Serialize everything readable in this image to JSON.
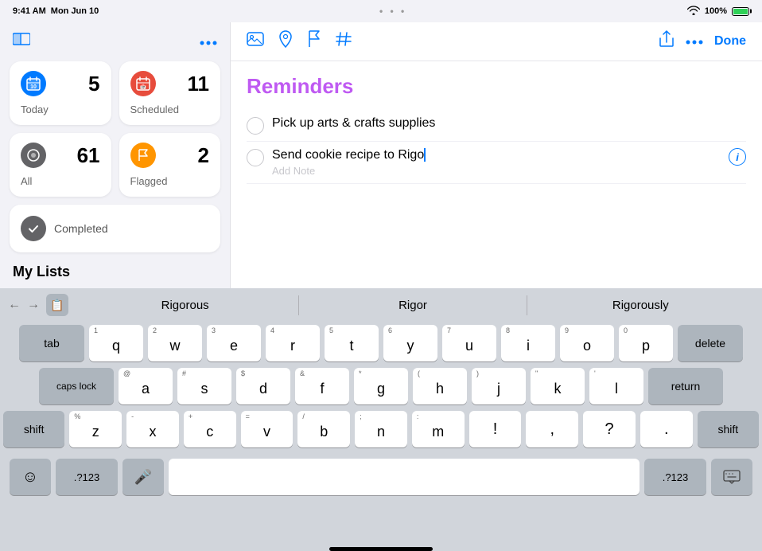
{
  "statusBar": {
    "time": "9:41 AM",
    "date": "Mon Jun 10",
    "centerDots": "•  •  •",
    "wifi": "WiFi",
    "battery": "100%"
  },
  "sidebar": {
    "moreIcon": "•••",
    "smartLists": [
      {
        "id": "today",
        "label": "Today",
        "count": "5",
        "iconColor": "#007aff",
        "iconSymbol": "📅"
      },
      {
        "id": "scheduled",
        "label": "Scheduled",
        "count": "11",
        "iconColor": "#e74c3c",
        "iconSymbol": "📅"
      },
      {
        "id": "all",
        "label": "All",
        "count": "61",
        "iconColor": "#1c1c1e",
        "iconSymbol": "⊟"
      },
      {
        "id": "flagged",
        "label": "Flagged",
        "count": "2",
        "iconColor": "#ff9500",
        "iconSymbol": "⚑"
      }
    ],
    "completed": {
      "label": "Completed",
      "iconColor": "#636366",
      "iconSymbol": "✓"
    },
    "myListsHeader": "My Lists"
  },
  "toolbar": {
    "icons": [
      "🖼",
      "➤",
      "🚩",
      "#"
    ],
    "shareLabel": "↑",
    "moreLabel": "•••",
    "doneLabel": "Done"
  },
  "reminders": {
    "title": "Reminders",
    "items": [
      {
        "id": "item1",
        "text": "Pick up arts & crafts supplies",
        "editing": false
      },
      {
        "id": "item2",
        "text": "Send cookie recipe to Rigo",
        "editing": true,
        "addNote": "Add Note"
      }
    ]
  },
  "autocomplete": {
    "suggestions": [
      "Rigorous",
      "Rigor",
      "Rigorously"
    ]
  },
  "keyboard": {
    "rows": [
      {
        "type": "letter",
        "keys": [
          {
            "char": "q",
            "num": "1"
          },
          {
            "char": "w",
            "num": "2"
          },
          {
            "char": "e",
            "num": "3"
          },
          {
            "char": "r",
            "num": "4"
          },
          {
            "char": "t",
            "num": "5"
          },
          {
            "char": "y",
            "num": "6"
          },
          {
            "char": "u",
            "num": "7"
          },
          {
            "char": "i",
            "num": "8"
          },
          {
            "char": "o",
            "num": "9"
          },
          {
            "char": "p",
            "num": "0"
          }
        ],
        "leftSpecial": {
          "label": "tab"
        },
        "rightSpecial": {
          "label": "delete"
        }
      },
      {
        "type": "letter",
        "keys": [
          {
            "char": "a",
            "num": "@"
          },
          {
            "char": "s",
            "num": "#"
          },
          {
            "char": "d",
            "num": "$"
          },
          {
            "char": "f",
            "num": "&"
          },
          {
            "char": "g",
            "num": "*"
          },
          {
            "char": "h",
            "num": "("
          },
          {
            "char": "j",
            "num": ")"
          },
          {
            "char": "k",
            "num": "\""
          },
          {
            "char": "l",
            "num": "'"
          }
        ],
        "leftSpecial": {
          "label": "caps lock"
        },
        "rightSpecial": {
          "label": "return"
        }
      },
      {
        "type": "letter",
        "keys": [
          {
            "char": "z",
            "num": "%"
          },
          {
            "char": "x",
            "num": "-"
          },
          {
            "char": "c",
            "num": "+"
          },
          {
            "char": "v",
            "num": "="
          },
          {
            "char": "b",
            "num": "/"
          },
          {
            "char": "n",
            "num": ";"
          },
          {
            "char": "m",
            "num": ":"
          },
          {
            "char": "!",
            "num": ""
          },
          {
            "char": "?",
            "num": ""
          }
        ],
        "leftSpecial": {
          "label": "shift"
        },
        "rightSpecial": {
          "label": "shift"
        }
      }
    ],
    "bottomRow": {
      "emoji": "☺",
      "numbers": ".?123",
      "mic": "🎤",
      "space": "",
      "numbers2": ".?123",
      "keyboard": "⌨"
    }
  }
}
